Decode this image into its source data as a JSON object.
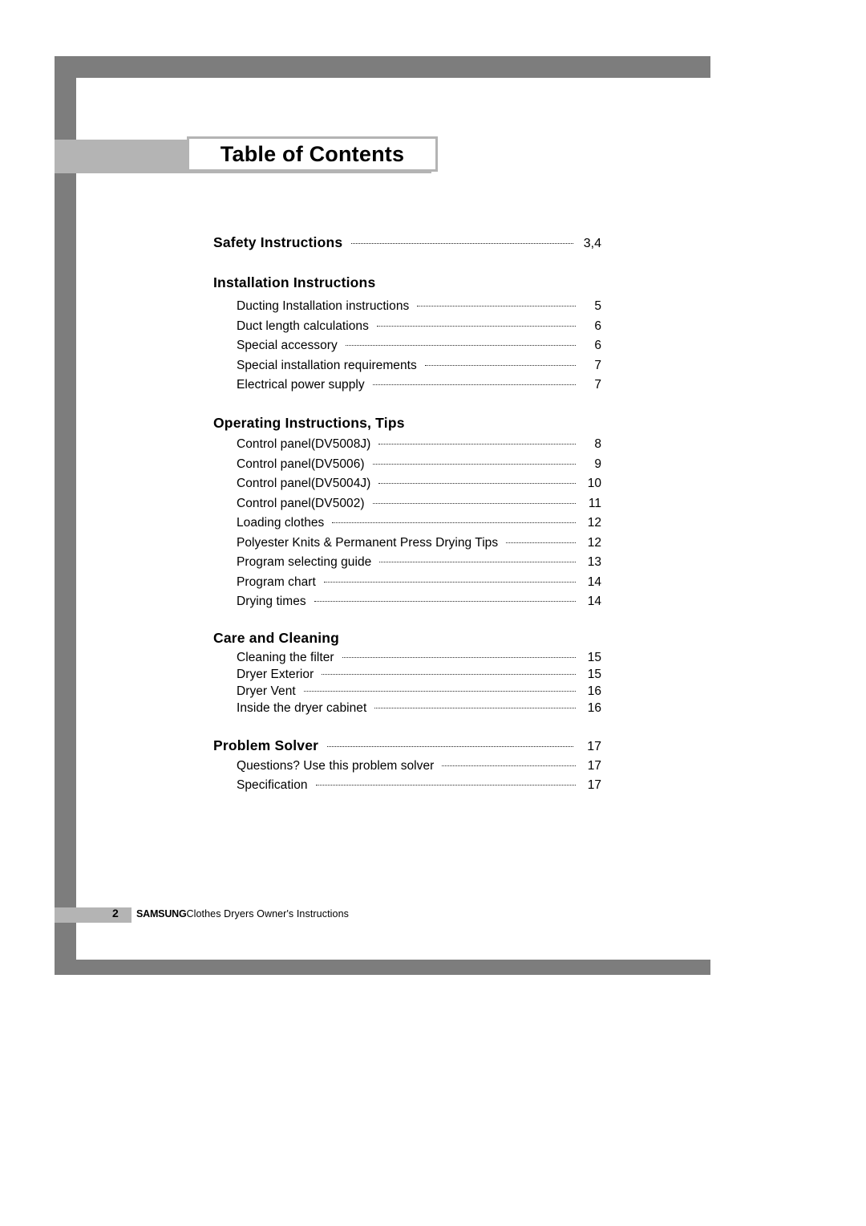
{
  "page": {
    "title": "Table of Contents",
    "frame_color": "#7d7d7d",
    "band_color": "#b4b4b4"
  },
  "toc": {
    "sections": [
      {
        "heading": "Safety Instructions",
        "heading_page": "3,4",
        "has_leader": true,
        "items": []
      },
      {
        "heading": "Installation Instructions",
        "heading_page": "",
        "has_leader": false,
        "items": [
          {
            "label": "Ducting Installation instructions",
            "page": "5"
          },
          {
            "label": "Duct length calculations",
            "page": "6"
          },
          {
            "label": "Special accessory",
            "page": "6"
          },
          {
            "label": "Special installation requirements",
            "page": "7"
          },
          {
            "label": "Electrical power supply",
            "page": "7"
          }
        ]
      },
      {
        "heading": "Operating Instructions, Tips",
        "heading_page": "",
        "has_leader": false,
        "items": [
          {
            "label": "Control panel(DV5008J)",
            "page": "8"
          },
          {
            "label": "Control panel(DV5006)",
            "page": "9"
          },
          {
            "label": "Control panel(DV5004J)",
            "page": "10"
          },
          {
            "label": "Control panel(DV5002)",
            "page": "11"
          },
          {
            "label": "Loading clothes",
            "page": "12"
          },
          {
            "label": "Polyester Knits & Permanent Press Drying Tips",
            "page": "12"
          },
          {
            "label": "Program selecting guide",
            "page": "13"
          },
          {
            "label": "Program chart",
            "page": "14"
          },
          {
            "label": "Drying times",
            "page": "14"
          }
        ]
      },
      {
        "heading": "Care and Cleaning",
        "heading_page": "",
        "has_leader": false,
        "items": [
          {
            "label": "Cleaning the filter",
            "page": "15"
          },
          {
            "label": "Dryer Exterior",
            "page": "15"
          },
          {
            "label": "Dryer Vent",
            "page": "16"
          },
          {
            "label": "Inside the dryer cabinet",
            "page": "16"
          }
        ]
      },
      {
        "heading": "Problem Solver",
        "heading_page": "17",
        "has_leader": true,
        "items": [
          {
            "label": "Questions? Use this problem solver",
            "page": "17"
          },
          {
            "label": "Specification",
            "page": "17"
          }
        ]
      }
    ]
  },
  "footer": {
    "page_number": "2",
    "brand": "SAMSUNG",
    "text": "Clothes Dryers Owner's Instructions"
  }
}
